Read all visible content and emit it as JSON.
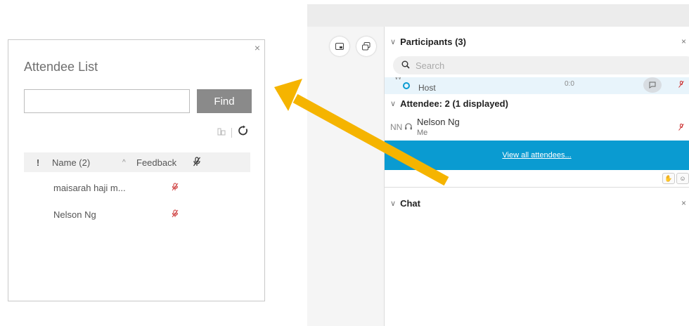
{
  "dialog": {
    "title": "Attendee List",
    "close_glyph": "×",
    "search_value": "",
    "find_label": "Find",
    "table": {
      "flag_header": "!",
      "name_header": "Name (2)",
      "sort_glyph": "^",
      "feedback_header": "Feedback",
      "rows": [
        {
          "name": "maisarah haji m..."
        },
        {
          "name": "Nelson Ng"
        }
      ]
    }
  },
  "panel": {
    "participants_header": "Participants (3)",
    "close_glyph": "×",
    "search_placeholder": "Search",
    "host": {
      "avatar_text": "W",
      "role": "Host",
      "stat": "0:0"
    },
    "attendee_header": "Attendee: 2 (1 displayed)",
    "attendee": {
      "initials": "NN",
      "name": "Nelson Ng",
      "sub": "Me"
    },
    "view_all_label": "View all attendees...",
    "chat_header": "Chat"
  },
  "colors": {
    "find_button": "#8a8a8a",
    "view_all_bar": "#0a9bd1",
    "arrow": "#f5b400",
    "mic_muted": "#cc3333"
  }
}
